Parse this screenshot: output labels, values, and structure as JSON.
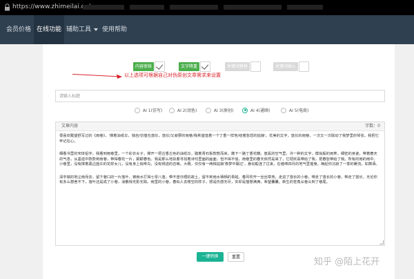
{
  "browser": {
    "url": "https://www.zhimeilai.cn/gongneng"
  },
  "nav": {
    "items": [
      {
        "label": "会员价格",
        "active": false
      },
      {
        "label": "在线功能",
        "active": true
      },
      {
        "label": "辅助工具",
        "active": false,
        "dropdown": true
      },
      {
        "label": "使用帮助",
        "active": false
      }
    ]
  },
  "toggles": [
    {
      "label": "内容审核",
      "checked": true,
      "color": "#4cae4c"
    },
    {
      "label": "文字降重",
      "checked": true,
      "color": "#4cae4c"
    },
    {
      "label": "关键词替换",
      "checked": false,
      "color": "#d9d9d9"
    },
    {
      "label": "关键词插入",
      "checked": false,
      "color": "#d9d9d9"
    }
  ],
  "hint": "以上选项可根据自己对伪原创文章需求来设置",
  "title_input": {
    "placeholder": "请输入标题"
  },
  "ai_modes": [
    {
      "label": "AI 1(仿写)",
      "checked": false
    },
    {
      "label": "AI 2(润色)",
      "checked": false
    },
    {
      "label": "AI 3(原创)",
      "checked": false
    },
    {
      "label": "AI 4(通顺)",
      "checked": true
    },
    {
      "label": "AI 5(电商)",
      "checked": false
    }
  ],
  "editor": {
    "label": "文章内容",
    "count_label": "字数：0",
    "paragraphs": [
      "很喜欢戴望舒写过的《雨巷》，'撑着油纸伞，独自/彷徨在悠长，悠长/又寂寥的雨巷/我希望逢着一个丁香一样地/结着愁怨的姑娘'。优美的文字，悠长的雨巷，一次又一次联动了我梦里的琴弦，我把它牢记在心。",
      "细看书里的宋体铅字，我看到雨巷里，一个彩衣女子，撑开一把古香古色的油纸伞，踏着青石板款款而来，撒下一路丁香花瓣。氤氲的空气里，许一种的文字，模拟般的雨笑，细密的身姿，带着春天的气息，从墨迹中款款到雨巷，带得春花一片，颠颠春色。我是那么地执着寻找着诗句里面的画面，但不得不信，雨巷里的春天依然是来了，它把欢喜带给了我，把春愁带给了我。所有的雨的雨中，小巷里，没有撑着黑边蓝伞的花样女儿，没有身上俏啡鸟，没有锈迹的召唤。大概，仅仅有一两株姑娘'像梦中飘过'，悬动般连了过来，在缠绵四月的地气里摇曳，唤起你沉寂了一季的暖流，如萧洒。",
      "清辛做的地尘雨而去，留下巷口的一片落叶，被雨水打得七零八落，带不曾日晒的故土，留不到雨水栖栖的青蛙。春风吹开一丝丝草苑，走进了悠长的小巷，带走了悠长的小巷，带走了悠长，无论你有多么憩舍不下，落叶还是成了小巷，消散得无影无踪。雨里的小巷，春似人去楼空的样子，想是伤感无尽，实却是憧憬满满，希望囊囊。新生的苍角从巷头到了巷尾。"
    ]
  },
  "buttons": {
    "convert": "一键转换",
    "reset": "重置"
  },
  "watermark": "知乎 @陌上花开"
}
